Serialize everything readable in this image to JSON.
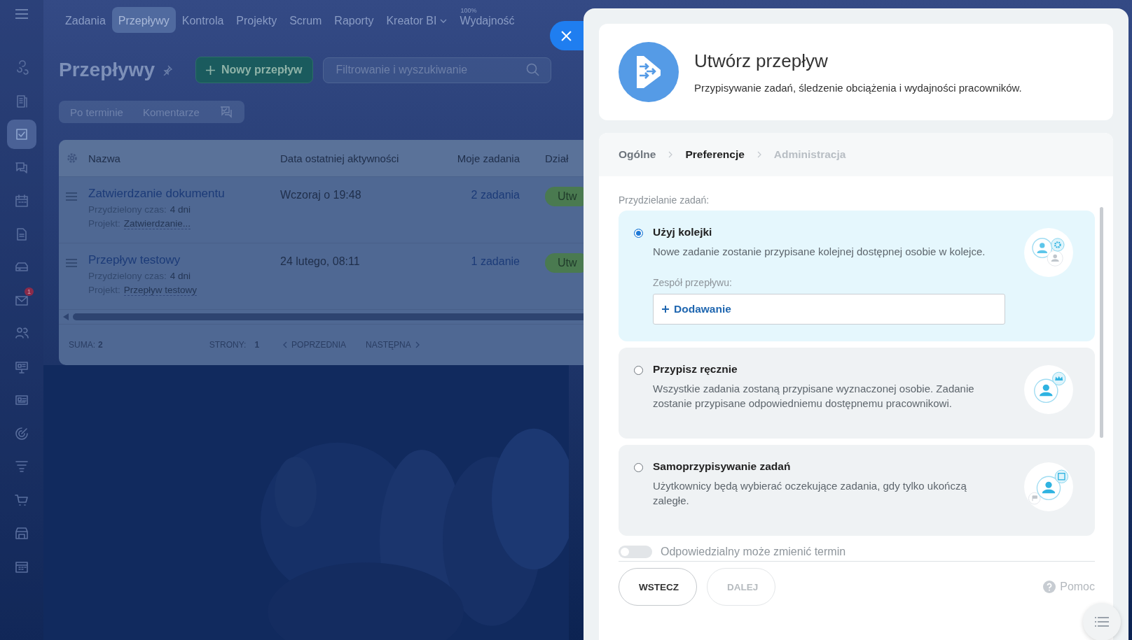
{
  "nav": {
    "items": [
      {
        "label": "Zadania",
        "selected": false
      },
      {
        "label": "Przepływy",
        "selected": true
      },
      {
        "label": "Kontrola",
        "selected": false
      },
      {
        "label": "Projekty",
        "selected": false
      },
      {
        "label": "Scrum",
        "selected": false
      },
      {
        "label": "Raporty",
        "selected": false
      },
      {
        "label": "Kreator BI",
        "selected": false,
        "dropdown": true
      },
      {
        "label": "Wydajność",
        "selected": false,
        "badge": "100%"
      }
    ]
  },
  "sidebar": {
    "items": [
      {
        "selected": false
      },
      {
        "selected": false
      },
      {
        "selected": true
      },
      {
        "selected": false
      },
      {
        "selected": false
      },
      {
        "selected": false
      },
      {
        "selected": false
      },
      {
        "selected": false,
        "badge": "1"
      },
      {
        "selected": false
      },
      {
        "selected": false
      },
      {
        "selected": false
      },
      {
        "selected": false
      },
      {
        "selected": false
      },
      {
        "selected": false
      },
      {
        "selected": false
      },
      {
        "selected": false
      }
    ]
  },
  "page": {
    "title": "Przepływy",
    "new_button": "Nowy przepływ",
    "search": {
      "placeholder": "Filtrowanie i wyszukiwanie"
    },
    "filters": [
      "Po terminie",
      "Komentarze"
    ]
  },
  "table": {
    "columns": [
      "Nazwa",
      "Data ostatniej aktywności",
      "Moje zadania",
      "Dział"
    ],
    "rows": [
      {
        "name": "Zatwierdzanie dokumentu",
        "time_label": "Przydzielony czas:",
        "time": "4 dni",
        "project_label": "Projekt:",
        "project": "Zatwierdzanie...",
        "date": "Wczoraj o 19:48",
        "tasks": "2 zadania",
        "status": "Utw"
      },
      {
        "name": "Przepływ testowy",
        "time_label": "Przydzielony czas:",
        "time": "4 dni",
        "project_label": "Projekt:",
        "project": "Przepływ testowy",
        "date": "24 lutego, 08:11",
        "tasks": "1 zadanie",
        "status": "Utw"
      }
    ],
    "footer": {
      "total_label": "SUMA:",
      "total": "2",
      "pages_label": "STRONY:",
      "pages": "1",
      "prev": "POPRZEDNIA",
      "next": "NASTĘPNA"
    }
  },
  "panel": {
    "title": "Utwórz przepływ",
    "description": "Przypisywanie zadań, śledzenie obciążenia i wydajności pracowników.",
    "steps": [
      {
        "label": "Ogólne",
        "selected": false,
        "disabled": false
      },
      {
        "label": "Preferencje",
        "selected": true,
        "disabled": false
      },
      {
        "label": "Administracja",
        "selected": false,
        "disabled": true
      }
    ],
    "section_label": "Przydzielanie zadań:",
    "options": [
      {
        "kind": "queue",
        "selected": true,
        "title": "Użyj kolejki",
        "description": "Nowe zadanie zostanie przypisane kolejnej dostępnej osobie w kolejce.",
        "team_label": "Zespół przepływu:",
        "add_button": "Dodawanie"
      },
      {
        "kind": "manual",
        "selected": false,
        "title": "Przypisz ręcznie",
        "description": "Wszystkie zadania zostaną przypisane wyznaczonej osobie. Zadanie zostanie przypisane odpowiedniemu dostępnemu pracownikowi."
      },
      {
        "kind": "self",
        "selected": false,
        "title": "Samoprzypisywanie zadań",
        "description": "Użytkownicy będą wybierać oczekujące zadania, gdy tylko ukończą zaległe."
      }
    ],
    "toggle": {
      "label": "Odpowiedzialny może zmienić termin",
      "on": false
    },
    "back_button": "WSTECZ",
    "next_button": {
      "label": "DALEJ",
      "disabled": true
    },
    "help": "Pomoc"
  }
}
